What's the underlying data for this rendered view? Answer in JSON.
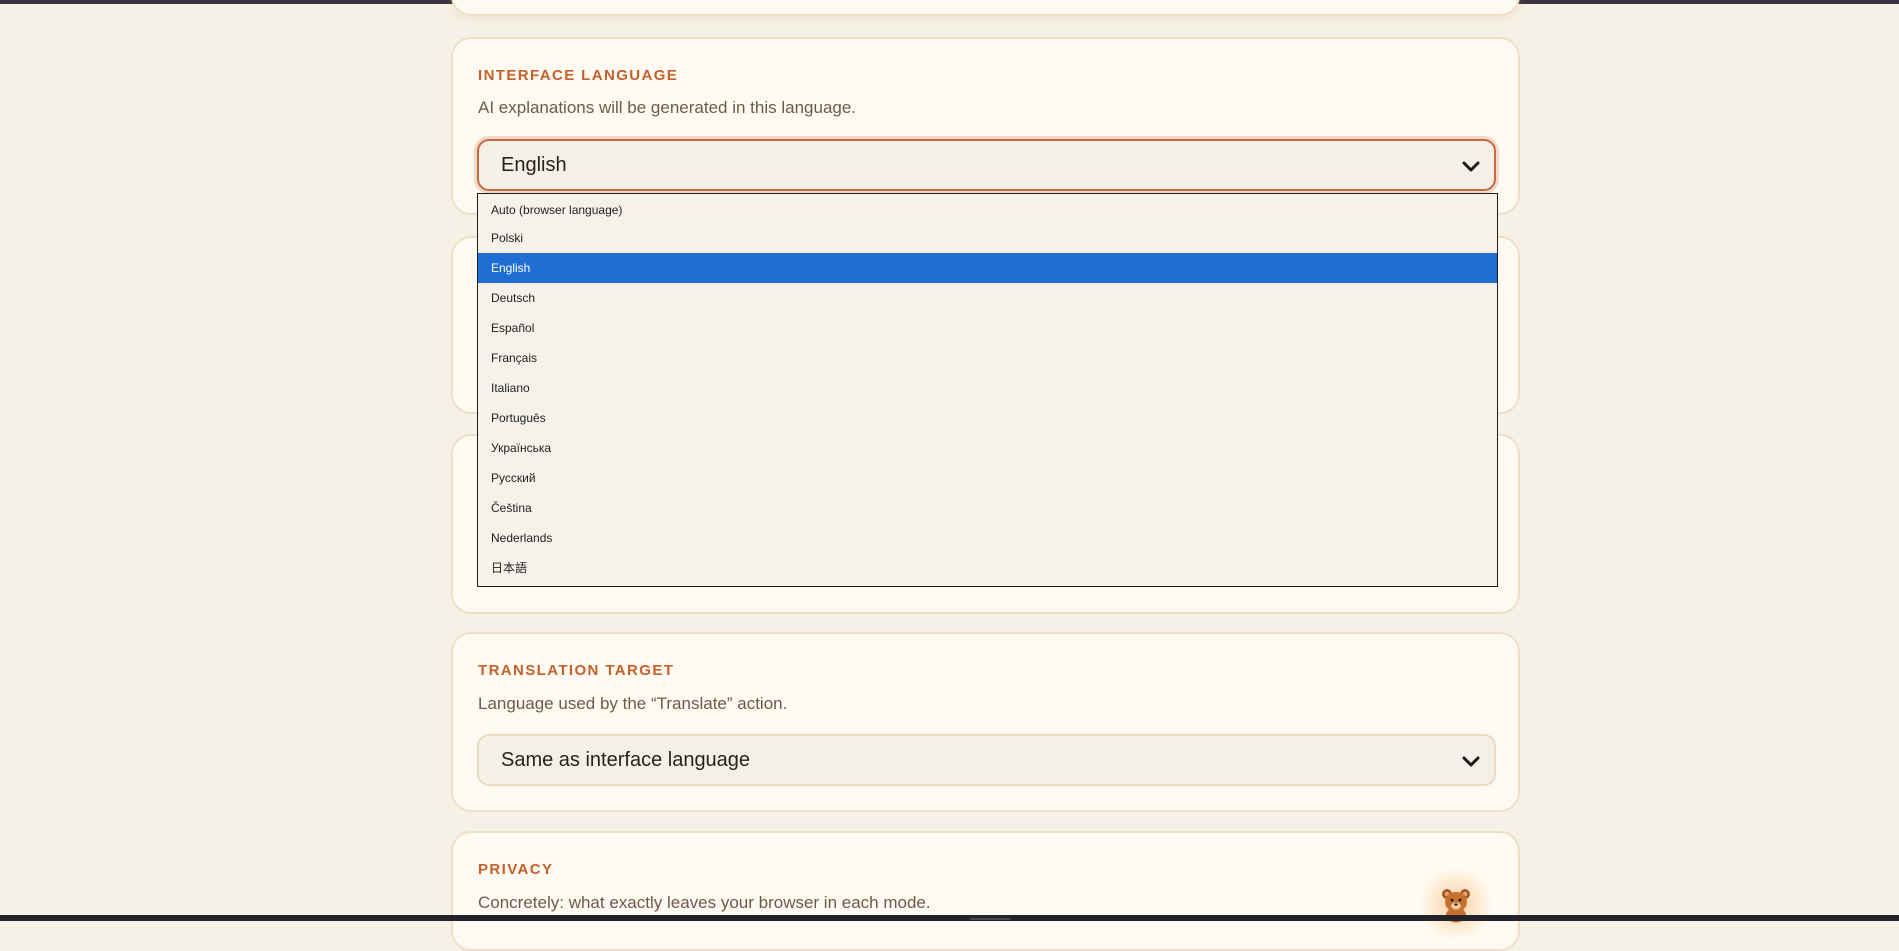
{
  "interface_language": {
    "title": "INTERFACE LANGUAGE",
    "description": "AI explanations will be generated in this language.",
    "selected": "English",
    "options": [
      "Auto (browser language)",
      "Polski",
      "English",
      "Deutsch",
      "Español",
      "Français",
      "Italiano",
      "Português",
      "Українська",
      "Русский",
      "Čeština",
      "Nederlands",
      "日本語"
    ],
    "highlighted_option": "English"
  },
  "translation_target": {
    "title": "TRANSLATION TARGET",
    "description": "Language used by the “Translate” action.",
    "selected": "Same as interface language"
  },
  "privacy": {
    "title": "PRIVACY",
    "description": "Concretely: what exactly leaves your browser in each mode."
  },
  "icons": {
    "select_arrow": "chevron-down-icon",
    "mascot": "bear-icon"
  },
  "colors": {
    "accent": "#c4602c",
    "highlight": "#1f6ed4",
    "background": "#f6f1e6",
    "card": "#fffaf1"
  }
}
